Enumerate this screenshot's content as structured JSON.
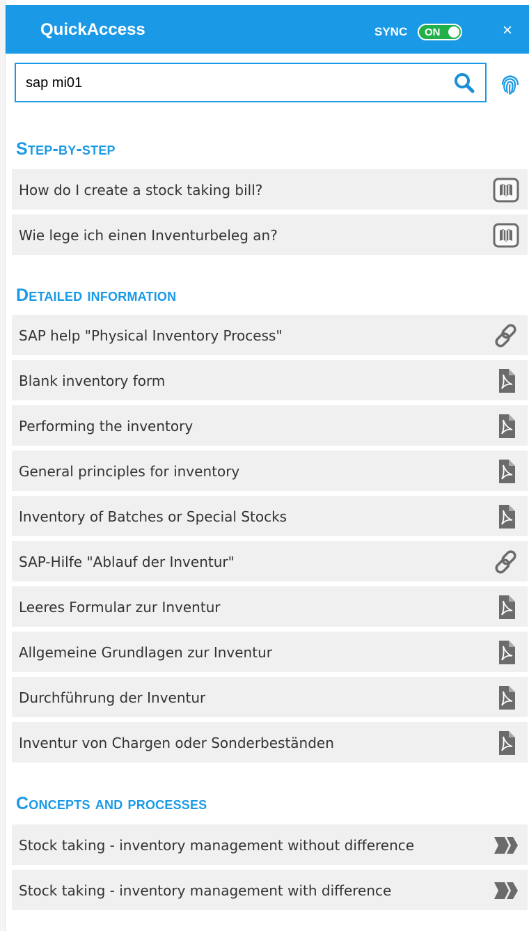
{
  "header": {
    "title": "QuickAccess",
    "sync_label": "SYNC",
    "sync_state": "ON",
    "close_glyph": "×",
    "background": "#1a9ae6"
  },
  "search": {
    "value": "sap mi01",
    "icon": "search-icon",
    "secondary_icon": "fingerprint-icon"
  },
  "sections": {
    "step_by_step": {
      "title": "Step-by-step",
      "items": [
        {
          "label": "How do I create a stock taking bill?",
          "icon": "book-icon"
        },
        {
          "label": "Wie lege ich einen Inventurbeleg an?",
          "icon": "book-icon"
        }
      ]
    },
    "detailed": {
      "title": "Detailed information",
      "items": [
        {
          "label": "SAP help \"Physical Inventory Process\"",
          "icon": "link-icon"
        },
        {
          "label": "Blank inventory form",
          "icon": "pdf-icon"
        },
        {
          "label": "Performing the inventory",
          "icon": "pdf-icon"
        },
        {
          "label": "General principles for inventory",
          "icon": "pdf-icon"
        },
        {
          "label": "Inventory of Batches or Special Stocks",
          "icon": "pdf-icon"
        },
        {
          "label": "SAP-Hilfe \"Ablauf der Inventur\"",
          "icon": "link-icon"
        },
        {
          "label": "Leeres Formular zur Inventur",
          "icon": "pdf-icon"
        },
        {
          "label": "Allgemeine Grundlagen zur Inventur",
          "icon": "pdf-icon"
        },
        {
          "label": "Durchführung der Inventur",
          "icon": "pdf-icon"
        },
        {
          "label": "Inventur von Chargen oder Sonderbeständen",
          "icon": "pdf-icon"
        }
      ]
    },
    "concepts": {
      "title": "Concepts and processes",
      "items": [
        {
          "label": "Stock taking - inventory management without difference",
          "icon": "process-chevrons-icon"
        },
        {
          "label": "Stock taking - inventory management with difference",
          "icon": "process-chevrons-icon"
        }
      ]
    }
  },
  "colors": {
    "accent": "#1a9ae6",
    "toggle_on": "#23b04a",
    "row_background": "#f0f0f0",
    "icon_gray": "#6b6b6b"
  }
}
